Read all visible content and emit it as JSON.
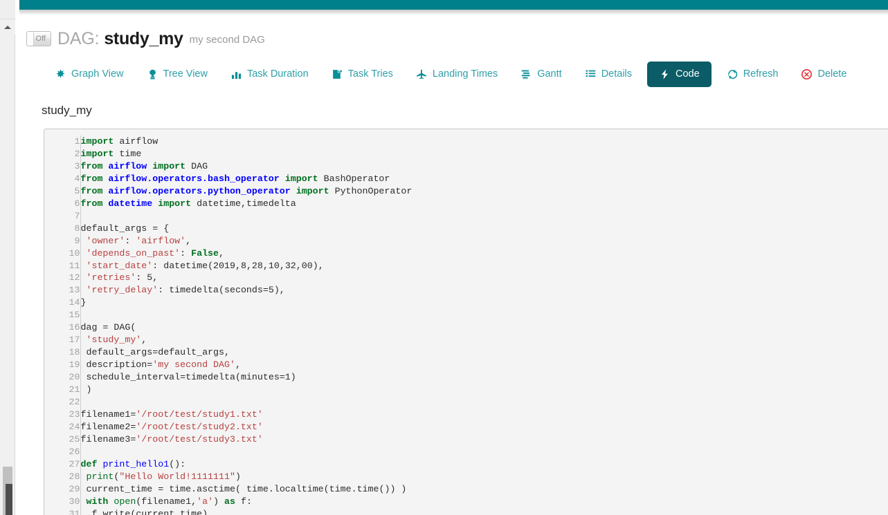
{
  "window": {
    "accent_teal": "#00808a",
    "active_tab_bg": "#0b5c66",
    "link_color": "#2d9fa8",
    "danger_color": "#e31e24"
  },
  "header": {
    "toggle_label": "Off",
    "dag_prefix": "DAG:",
    "dag_name": "study_my",
    "dag_description": "my second DAG"
  },
  "tabs": [
    {
      "label": "Graph View",
      "icon": "asterisk-icon",
      "active": false,
      "danger": false
    },
    {
      "label": "Tree View",
      "icon": "tree-icon",
      "active": false,
      "danger": false
    },
    {
      "label": "Task Duration",
      "icon": "bar-chart-icon",
      "active": false,
      "danger": false
    },
    {
      "label": "Task Tries",
      "icon": "file-upload-icon",
      "active": false,
      "danger": false
    },
    {
      "label": "Landing Times",
      "icon": "plane-icon",
      "active": false,
      "danger": false
    },
    {
      "label": "Gantt",
      "icon": "gantt-icon",
      "active": false,
      "danger": false
    },
    {
      "label": "Details",
      "icon": "list-icon",
      "active": false,
      "danger": false
    },
    {
      "label": "Code",
      "icon": "bolt-icon",
      "active": true,
      "danger": false
    },
    {
      "label": "Refresh",
      "icon": "refresh-icon",
      "active": false,
      "danger": false
    },
    {
      "label": "Delete",
      "icon": "delete-circle-icon",
      "active": false,
      "danger": true
    }
  ],
  "code_section": {
    "title": "study_my",
    "first_line": 1,
    "last_visible_line": 31,
    "lines": [
      {
        "n": 1,
        "text": "import airflow"
      },
      {
        "n": 2,
        "text": "import time"
      },
      {
        "n": 3,
        "text": "from airflow import DAG"
      },
      {
        "n": 4,
        "text": "from airflow.operators.bash_operator import BashOperator"
      },
      {
        "n": 5,
        "text": "from airflow.operators.python_operator import PythonOperator"
      },
      {
        "n": 6,
        "text": "from datetime import datetime,timedelta"
      },
      {
        "n": 7,
        "text": ""
      },
      {
        "n": 8,
        "text": "default_args = {"
      },
      {
        "n": 9,
        "text": " 'owner': 'airflow',"
      },
      {
        "n": 10,
        "text": " 'depends_on_past': False,"
      },
      {
        "n": 11,
        "text": " 'start_date': datetime(2019,8,28,10,32,00),"
      },
      {
        "n": 12,
        "text": " 'retries': 5,"
      },
      {
        "n": 13,
        "text": " 'retry_delay': timedelta(seconds=5),"
      },
      {
        "n": 14,
        "text": "}"
      },
      {
        "n": 15,
        "text": ""
      },
      {
        "n": 16,
        "text": "dag = DAG("
      },
      {
        "n": 17,
        "text": " 'study_my',"
      },
      {
        "n": 18,
        "text": " default_args=default_args,"
      },
      {
        "n": 19,
        "text": " description='my second DAG',"
      },
      {
        "n": 20,
        "text": " schedule_interval=timedelta(minutes=1)"
      },
      {
        "n": 21,
        "text": " )"
      },
      {
        "n": 22,
        "text": ""
      },
      {
        "n": 23,
        "text": "filename1='/root/test/study1.txt'"
      },
      {
        "n": 24,
        "text": "filename2='/root/test/study2.txt'"
      },
      {
        "n": 25,
        "text": "filename3='/root/test/study3.txt'"
      },
      {
        "n": 26,
        "text": ""
      },
      {
        "n": 27,
        "text": "def print_hello1():"
      },
      {
        "n": 28,
        "text": " print(\"Hello World!1111111\")"
      },
      {
        "n": 29,
        "text": " current_time = time.asctime( time.localtime(time.time()) )"
      },
      {
        "n": 30,
        "text": " with open(filename1,'a') as f:"
      },
      {
        "n": 31,
        "text": "  f.write(current_time)"
      }
    ]
  }
}
